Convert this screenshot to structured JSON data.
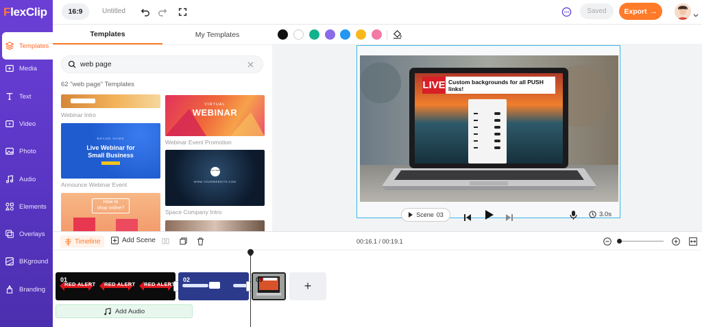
{
  "app": {
    "logo_text": "lexClip",
    "logo_first": "F"
  },
  "sidebar": {
    "items": [
      {
        "label": "Templates",
        "icon": "layers-icon",
        "active": true
      },
      {
        "label": "Media",
        "icon": "media-icon"
      },
      {
        "label": "Text",
        "icon": "text-icon"
      },
      {
        "label": "Video",
        "icon": "video-icon"
      },
      {
        "label": "Photo",
        "icon": "photo-icon"
      },
      {
        "label": "Audio",
        "icon": "music-icon"
      },
      {
        "label": "Elements",
        "icon": "elements-icon"
      },
      {
        "label": "Overlays",
        "icon": "overlays-icon"
      },
      {
        "label": "BKground",
        "icon": "background-icon"
      },
      {
        "label": "Branding",
        "icon": "branding-icon"
      }
    ]
  },
  "topbar": {
    "ratio": "16:9",
    "title": "Untitled",
    "saved": "Saved",
    "export": "Export"
  },
  "panel": {
    "tabs": [
      "Templates",
      "My Templates"
    ],
    "search_value": "web page",
    "result_count": "62 \"web page\" Templates",
    "templates": [
      {
        "label": "Webinar Intro"
      },
      {
        "label": "Webinar Event Promotion",
        "badge": "VIRTUAL",
        "title": "WEBINAR"
      },
      {
        "label": "Announce Webinar Event",
        "brand": "BRAND NAME",
        "title_l1": "Live Webinar for",
        "title_l2": "Small Business"
      },
      {
        "label": "Space Company Intro",
        "logo": "LOGO HERE",
        "site": "WWW.YOURWEBSITE.COM"
      },
      {
        "label": "",
        "title_l1": "How to",
        "title_l2": "shop online?"
      },
      {
        "label": ""
      }
    ]
  },
  "colorbar": {
    "swatches": [
      "#111111",
      "#ffffff",
      "#12b28c",
      "#8a6be8",
      "#2196f3",
      "#f8b81c",
      "#f27aa5"
    ]
  },
  "canvas": {
    "live_badge": "LIVE",
    "banner_text": "Custom backgrounds for all PUSH links!",
    "scene_label": "Scene",
    "scene_number": "03",
    "duration": "3.0s"
  },
  "timeline": {
    "tab_label": "Timeline",
    "add_scene": "Add Scene",
    "time_current": "00:16.1",
    "time_total": "00:19.1",
    "time_separator": " / ",
    "clips": [
      {
        "num": "01",
        "text": "RED ALERT"
      },
      {
        "num": "02"
      },
      {
        "num": "03"
      }
    ],
    "add_clip": "+",
    "add_audio": "Add Audio"
  }
}
